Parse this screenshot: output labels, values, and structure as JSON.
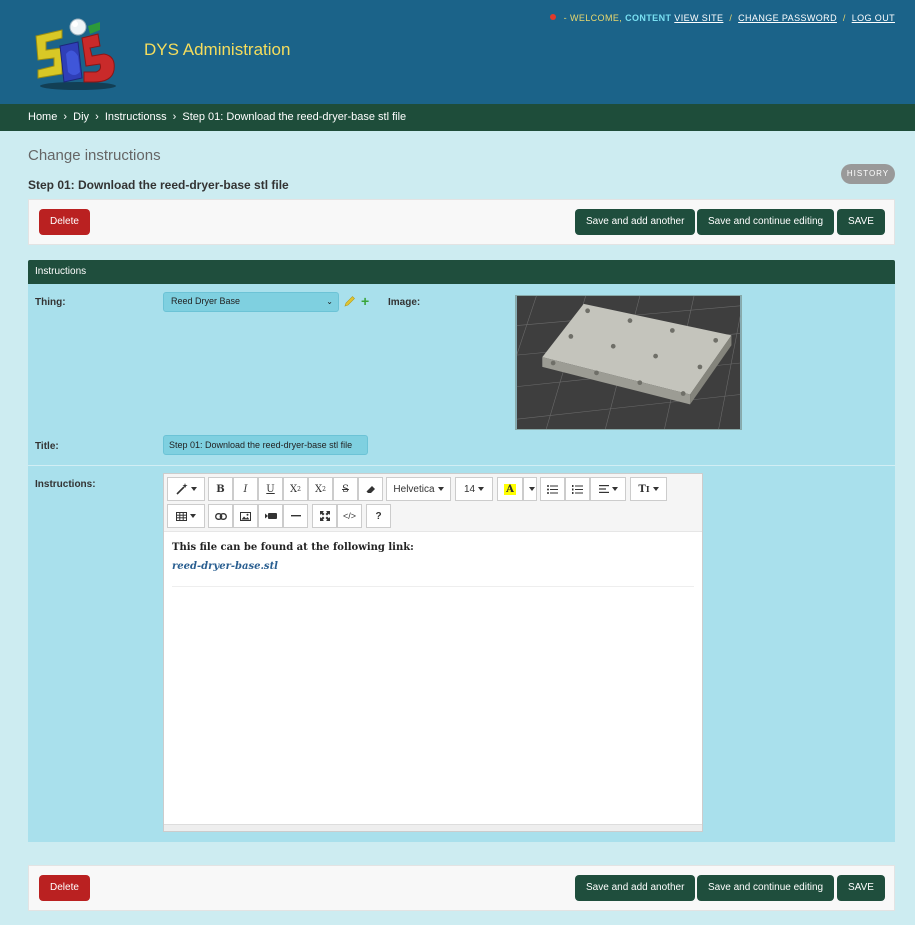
{
  "header": {
    "site_name": "DYS Administration",
    "welcome": "- WELCOME,",
    "username": "CONTENT",
    "view_site": "VIEW SITE",
    "change_password": "CHANGE PASSWORD",
    "log_out": "LOG OUT",
    "separator": "/"
  },
  "breadcrumbs": {
    "items": [
      "Home",
      "Diy",
      "Instructionss",
      "Step 01: Download the reed-dryer-base stl file"
    ],
    "separator": "›"
  },
  "page": {
    "title": "Change instructions",
    "object_title": "Step 01: Download the reed-dryer-base stl file",
    "history_label": "HISTORY"
  },
  "actions": {
    "delete": "Delete",
    "save_add": "Save and add another",
    "save_continue": "Save and continue editing",
    "save": "SAVE"
  },
  "fieldset": {
    "title": "Instructions",
    "thing_label": "Thing:",
    "thing_value": "Reed Dryer Base",
    "image_label": "Image:",
    "title_label": "Title:",
    "title_value": "Step 01: Download the reed-dryer-base stl file",
    "instructions_label": "Instructions:"
  },
  "editor": {
    "font_name": "Helvetica",
    "font_size": "14",
    "content_text": "This file can be found at the following link:",
    "content_link": "reed-dryer-base.stl",
    "toolbar_icons": [
      "magic-icon",
      "bold-icon",
      "italic-icon",
      "underline-icon",
      "superscript-icon",
      "subscript-icon",
      "strikethrough-icon",
      "eraser-icon",
      "font-name-dropdown",
      "font-size-dropdown",
      "highlight-color-icon",
      "color-caret-icon",
      "unordered-list-icon",
      "ordered-list-icon",
      "paragraph-align-icon",
      "text-height-icon",
      "table-icon",
      "link-icon",
      "picture-icon",
      "video-icon",
      "horizontal-rule-icon",
      "fullscreen-icon",
      "code-view-icon",
      "help-icon"
    ]
  },
  "colors": {
    "header": "#1b6389",
    "breadcrumbs": "#1e4d3a",
    "button_green": "#1f4e3d",
    "button_delete": "#ba2121",
    "page_bg": "#cdecf1",
    "field_bg": "#a9e0ec"
  }
}
